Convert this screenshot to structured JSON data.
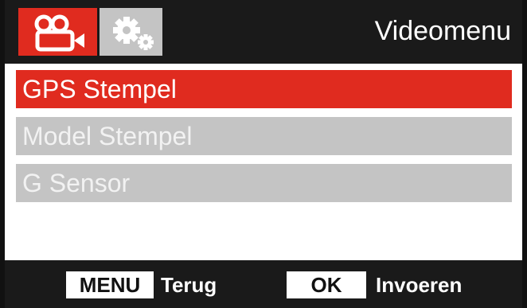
{
  "header": {
    "title": "Videomenu",
    "tabs": [
      {
        "icon": "video-camera-icon",
        "active": true
      },
      {
        "icon": "gears-icon",
        "active": false
      }
    ]
  },
  "menu": {
    "items": [
      {
        "label": "GPS Stempel",
        "selected": true
      },
      {
        "label": "Model Stempel",
        "selected": false
      },
      {
        "label": "G Sensor",
        "selected": false
      }
    ]
  },
  "footer": {
    "menu_key": "MENU",
    "menu_action": "Terug",
    "ok_key": "OK",
    "ok_action": "Invoeren"
  },
  "colors": {
    "accent": "#e02b1f",
    "inactive": "#c4c4c4",
    "bar": "#1a1a1a"
  }
}
